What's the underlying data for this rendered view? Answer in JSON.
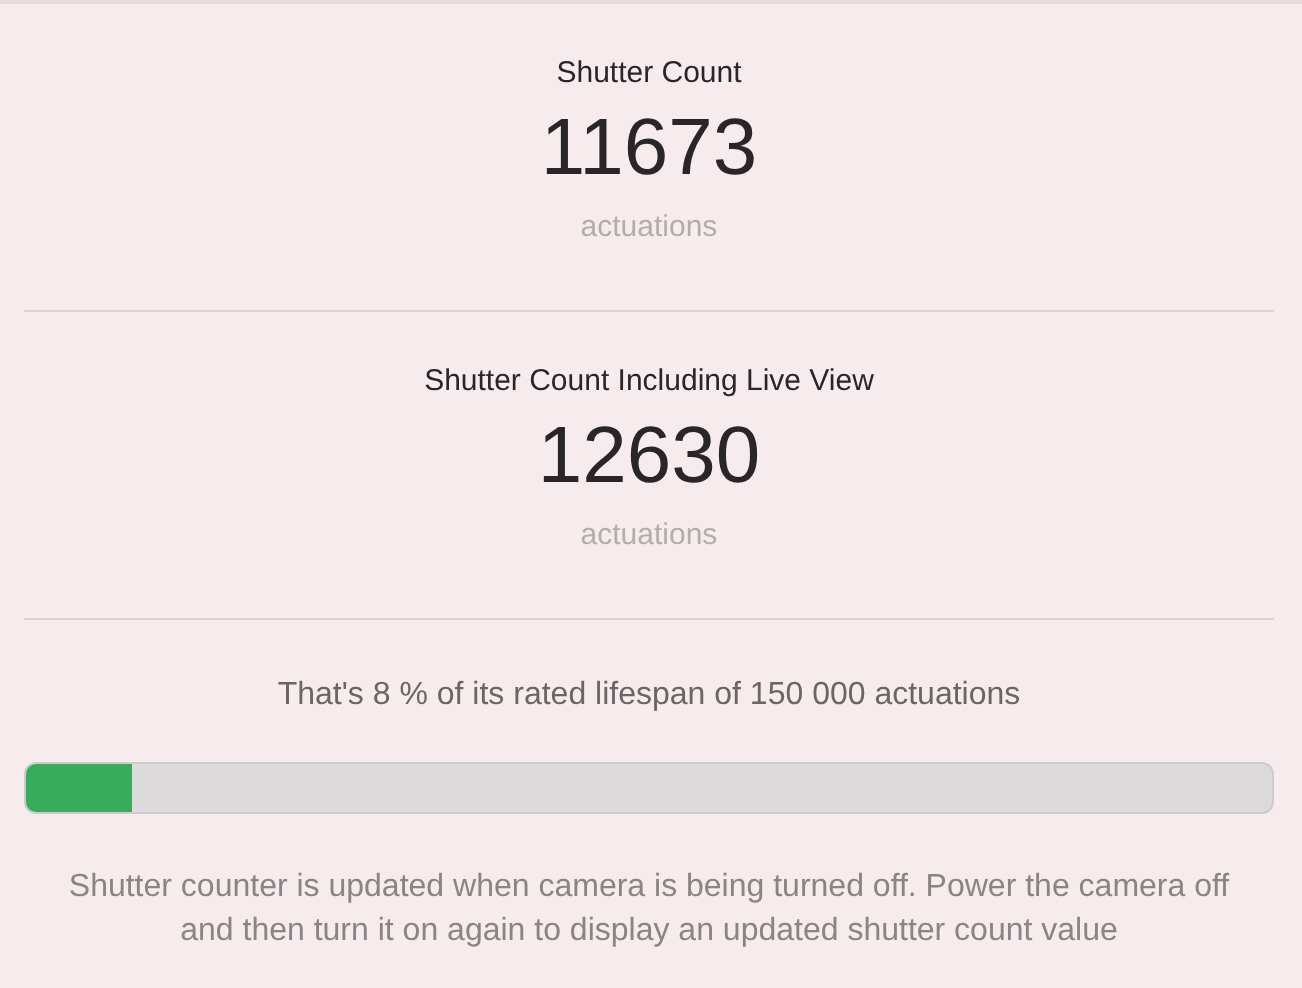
{
  "counts": [
    {
      "title": "Shutter Count",
      "value": "11673",
      "unit": "actuations"
    },
    {
      "title": "Shutter Count Including Live View",
      "value": "12630",
      "unit": "actuations"
    }
  ],
  "lifespan": {
    "text": "That's 8 % of its rated lifespan of 150 000 actuations",
    "level": 0.085
  },
  "note": "Shutter counter is updated when camera is being turned off. Power the camera off and then turn it on again to display an updated shutter count value"
}
